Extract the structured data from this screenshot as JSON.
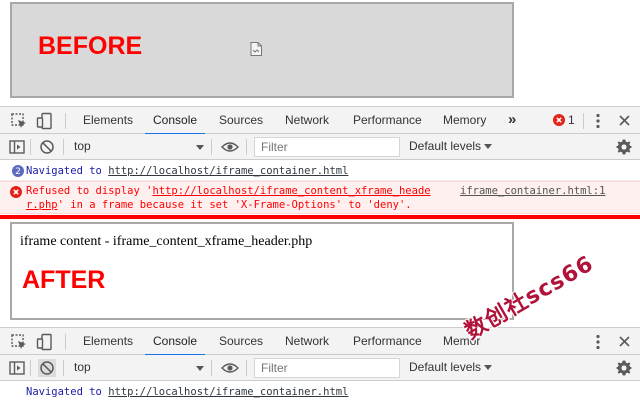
{
  "before": {
    "label": "BEFORE"
  },
  "after": {
    "label": "AFTER",
    "iframe_text": "iframe content - iframe_content_xframe_header.php"
  },
  "devtools": {
    "tabs": [
      "Elements",
      "Console",
      "Sources",
      "Network",
      "Performance",
      "Memory"
    ],
    "tabs_after": [
      "Elements",
      "Console",
      "Sources",
      "Network",
      "Performance",
      "Memor"
    ],
    "active_tab": "Console",
    "more_tabs": "»",
    "error_count": "1"
  },
  "toolbar": {
    "context": "top",
    "filter_placeholder": "Filter",
    "levels": "Default levels"
  },
  "console": {
    "info_badge": "2",
    "nav_prefix": "Navigated to ",
    "nav_url": "http://localhost/iframe_container.html",
    "error_prefix": "Refused to display '",
    "error_url_part1": "http://localhost/iframe_content_xframe_heade",
    "error_url_part2": "r.php",
    "error_suffix": "' in a frame because it set 'X-Frame-Options' to 'deny'.",
    "error_source": "iframe_container.html:1"
  },
  "watermark": "数创社scs66",
  "colors": {
    "accent": "#1a73e8",
    "error": "#ff0000",
    "label": "#ff0000"
  }
}
